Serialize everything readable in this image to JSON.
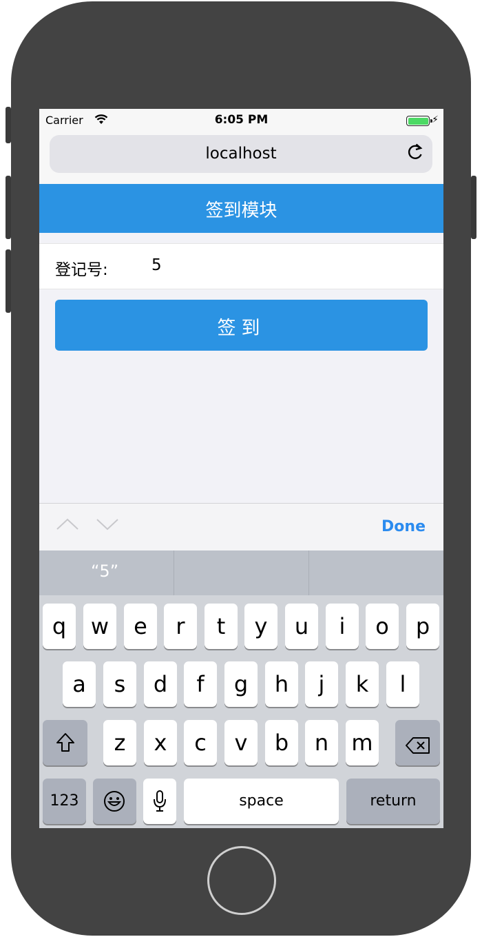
{
  "status_bar": {
    "carrier": "Carrier",
    "time": "6:05 PM"
  },
  "browser": {
    "url": "localhost",
    "reload_icon": "reload-icon"
  },
  "page": {
    "header_title": "签到模块",
    "field_label": "登记号:",
    "field_value": "5",
    "button_label": "签到"
  },
  "keyboard_accessory": {
    "done_label": "Done",
    "prev_icon": "chevron-up-icon",
    "next_icon": "chevron-down-icon"
  },
  "suggestion": {
    "text": "“5”"
  },
  "keyboard": {
    "row1": [
      "q",
      "w",
      "e",
      "r",
      "t",
      "y",
      "u",
      "i",
      "o",
      "p"
    ],
    "row2": [
      "a",
      "s",
      "d",
      "f",
      "g",
      "h",
      "j",
      "k",
      "l"
    ],
    "row3": [
      "z",
      "x",
      "c",
      "v",
      "b",
      "n",
      "m"
    ],
    "numbers_label": "123",
    "space_label": "space",
    "return_label": "return",
    "shift_icon": "shift-icon",
    "delete_icon": "delete-icon",
    "emoji_icon": "emoji-icon",
    "mic_icon": "microphone-icon"
  },
  "colors": {
    "accent": "#2b93e3",
    "phone_frame": "#434343",
    "done": "#2b8bef"
  }
}
